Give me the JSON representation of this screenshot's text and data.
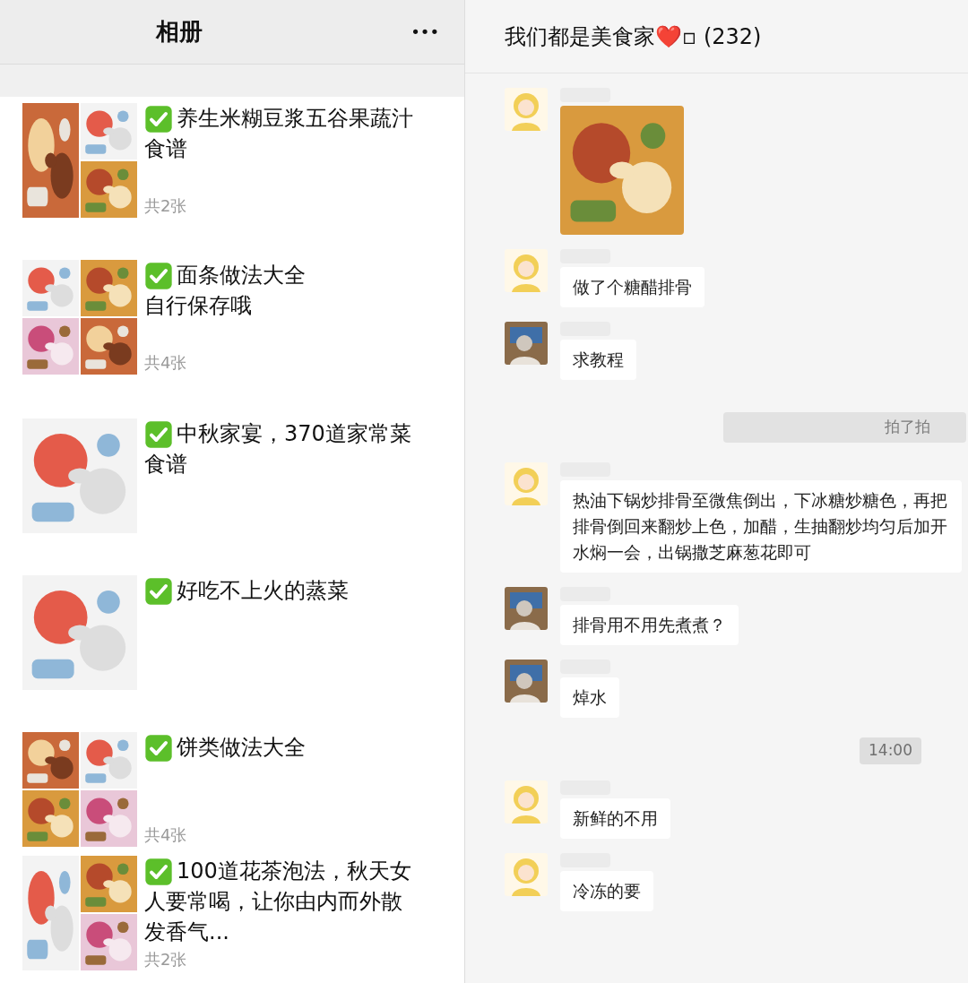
{
  "album": {
    "title": "相册",
    "more": "•••",
    "items": [
      {
        "kind": "split",
        "lines": [
          "养生米糊豆浆五谷果蔬汁",
          "食谱"
        ],
        "count": "共2张"
      },
      {
        "kind": "grid",
        "lines": [
          "面条做法大全",
          "自行保存哦"
        ],
        "count": "共4张"
      },
      {
        "kind": "single",
        "lines": [
          "中秋家宴，370道家常菜",
          "食谱"
        ]
      },
      {
        "kind": "single",
        "lines": [
          "好吃不上火的蒸菜"
        ]
      },
      {
        "kind": "grid",
        "lines": [
          "饼类做法大全"
        ],
        "count": "共4张"
      },
      {
        "kind": "split",
        "lines": [
          "100道花茶泡法，秋天女",
          "人要常喝，让你由内而外散",
          "发香气..."
        ],
        "count": "共2张"
      }
    ]
  },
  "chat": {
    "title": "我们都是美食家❤️▫ (232)",
    "messages": [
      {
        "sender": {
          "kind": "cartoon"
        }
      },
      {
        "kind": "text",
        "sender": {
          "kind": "cartoon"
        },
        "text": "做了个糖醋排骨"
      },
      {
        "kind": "text",
        "text": "求教程"
      },
      {
        "kind": "system",
        "text": "拍了拍"
      },
      {
        "kind": "text",
        "sender": {
          "kind": "cartoon"
        },
        "text": "热油下锅炒排骨至微焦倒出，下冰糖炒糖色，再把排骨倒回来翻炒上色，加醋，生抽翻炒均匀后加开水焖一会，出锅撒芝麻葱花即可"
      },
      {
        "kind": "text",
        "text": "排骨用不用先煮煮？"
      },
      {
        "kind": "text",
        "text": "焯水"
      },
      {
        "kind": "time",
        "text": "14:00"
      },
      {
        "kind": "text",
        "sender": {
          "kind": "cartoon"
        },
        "text": "新鲜的不用"
      },
      {
        "kind": "text",
        "sender": {
          "kind": "cartoon"
        },
        "text": "冷冻的要"
      }
    ]
  }
}
